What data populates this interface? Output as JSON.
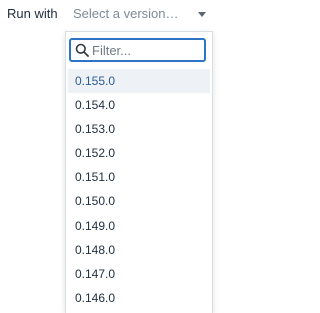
{
  "form": {
    "run_label": "Run with",
    "select_placeholder": "Select a version…",
    "caret_icon": "caret-down-icon"
  },
  "dropdown": {
    "filter_placeholder": "Filter...",
    "search_icon": "search-icon",
    "focus_color": "#2d74c7",
    "highlight_color": "#eef2f7",
    "versions": [
      "0.155.0",
      "0.154.0",
      "0.153.0",
      "0.152.0",
      "0.151.0",
      "0.150.0",
      "0.149.0",
      "0.148.0",
      "0.147.0",
      "0.146.0"
    ],
    "highlighted_index": 0
  }
}
